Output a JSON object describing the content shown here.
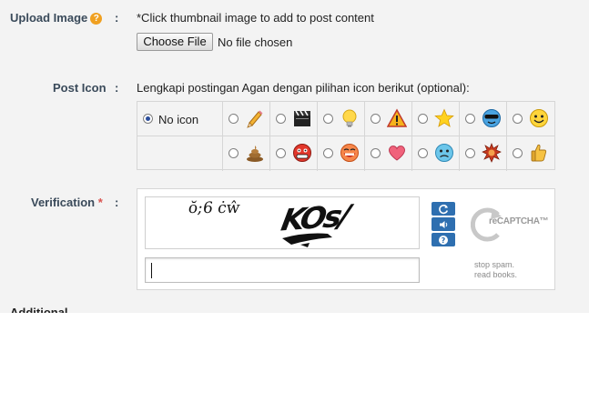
{
  "upload": {
    "label": "Upload Image",
    "help": "?",
    "colon": ":",
    "hint": "*Click thumbnail image to add to post content",
    "choose_file_label": "Choose File",
    "no_file_label": "No file chosen"
  },
  "post_icon": {
    "label": "Post Icon",
    "colon": ":",
    "description": "Lengkapi postingan Agan dengan pilihan icon berikut (optional):",
    "no_icon_label": "No icon",
    "selected": "No icon",
    "row1_icons": [
      "pencil-icon",
      "clapperboard-icon",
      "lightbulb-icon",
      "warning-icon",
      "star-icon",
      "cool-face-icon",
      "smile-face-icon"
    ],
    "row2_icons": [
      "poop-icon",
      "angry-face-icon",
      "grin-face-icon",
      "heart-icon",
      "sad-face-icon",
      "splat-icon",
      "thumbs-up-icon"
    ]
  },
  "verification": {
    "label": "Verification",
    "required_mark": "*",
    "colon": ":",
    "captcha_words": [
      "ŏ;6 ċŵ",
      "KOs/"
    ],
    "recaptcha_logo": "reCAPTCHA™",
    "tagline_line1": "stop spam.",
    "tagline_line2": "read books.",
    "reload_icon": "refresh-icon",
    "audio_icon": "audio-icon",
    "help_icon": "help-icon"
  },
  "additional": {
    "label": "Additional"
  },
  "colors": {
    "label": "#3a4a5a",
    "help_badge": "#f0a020",
    "required": "#d9534f",
    "recaptcha_buttons": "#2e6fb0",
    "radio_selected": "#2a4d9b"
  }
}
